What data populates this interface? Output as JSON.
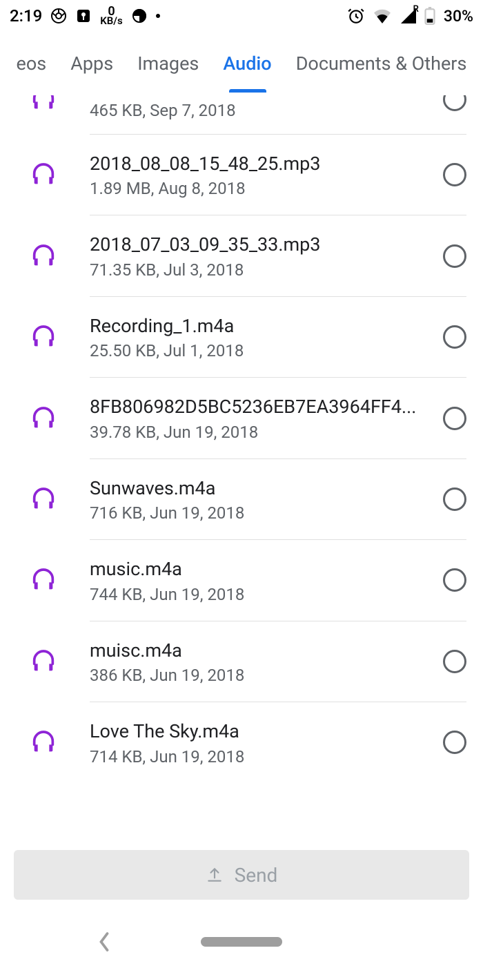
{
  "status": {
    "time": "2:19",
    "net_rate_value": "0",
    "net_rate_unit": "KB/s",
    "signal_badge": "R",
    "battery_pct": "30%"
  },
  "tabs": [
    {
      "label": "eos",
      "active": false
    },
    {
      "label": "Apps",
      "active": false
    },
    {
      "label": "Images",
      "active": false
    },
    {
      "label": "Audio",
      "active": true
    },
    {
      "label": "Documents & Others",
      "active": false
    }
  ],
  "files": [
    {
      "name": "",
      "meta": "465 KB, Sep 7, 2018",
      "partial": true
    },
    {
      "name": "2018_08_08_15_48_25.mp3",
      "meta": "1.89 MB, Aug 8, 2018"
    },
    {
      "name": "2018_07_03_09_35_33.mp3",
      "meta": "71.35 KB, Jul 3, 2018"
    },
    {
      "name": "Recording_1.m4a",
      "meta": "25.50 KB, Jul 1, 2018"
    },
    {
      "name": "8FB806982D5BC5236EB7EA3964FF4...",
      "meta": "39.78 KB, Jun 19, 2018"
    },
    {
      "name": "Sunwaves.m4a",
      "meta": "716 KB, Jun 19, 2018"
    },
    {
      "name": "music.m4a",
      "meta": "744 KB, Jun 19, 2018"
    },
    {
      "name": "muisc.m4a",
      "meta": "386 KB, Jun 19, 2018"
    },
    {
      "name": "Love The Sky.m4a",
      "meta": "714 KB, Jun 19, 2018"
    }
  ],
  "send": {
    "label": "Send"
  },
  "colors": {
    "accent": "#1a73e8",
    "audio_icon": "#8e24d6"
  }
}
